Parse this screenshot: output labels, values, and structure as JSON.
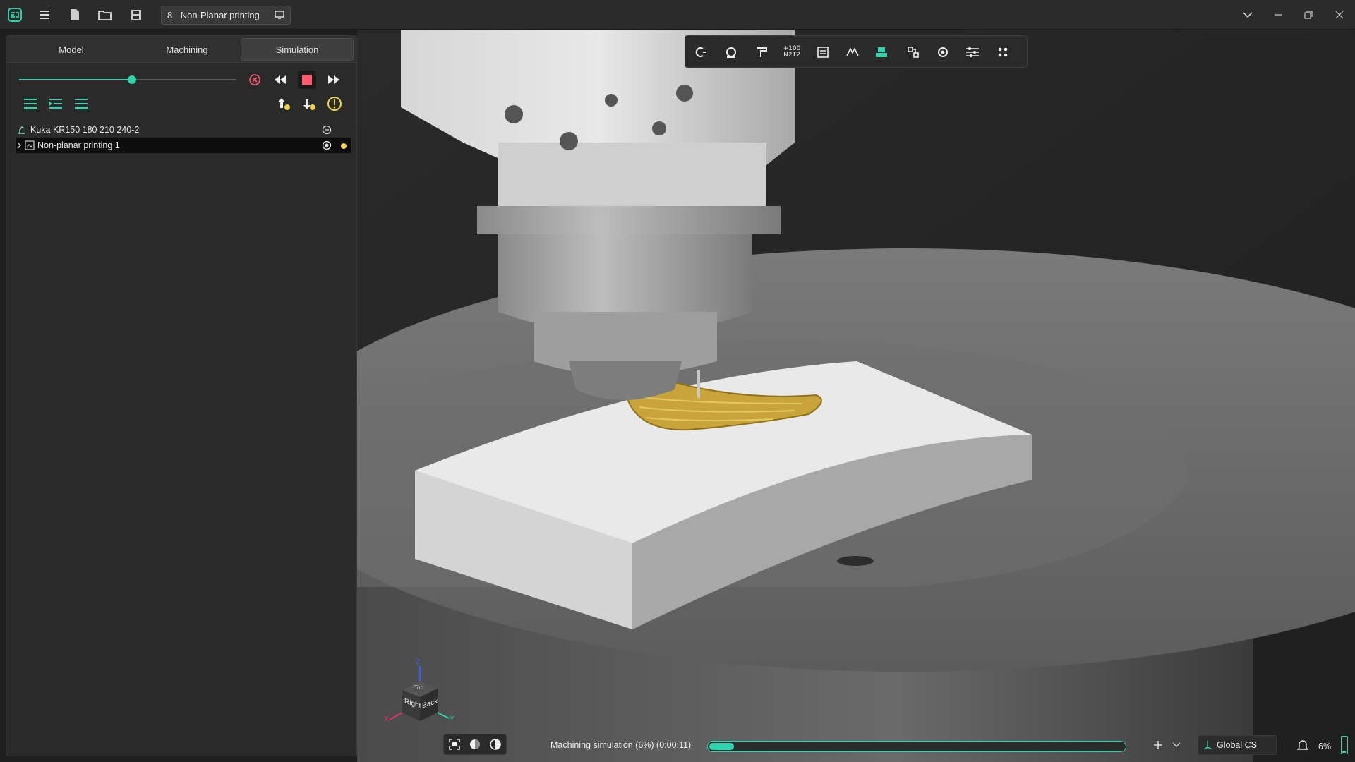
{
  "titlebar": {
    "document_tab": "8 - Non-Planar printing"
  },
  "panel": {
    "tabs": [
      {
        "label": "Model"
      },
      {
        "label": "Machining"
      },
      {
        "label": "Simulation"
      }
    ],
    "active_tab": "Simulation",
    "slider_position": 0.52,
    "tree": [
      {
        "label": "Kuka KR150 180 210 240-2"
      },
      {
        "label": "Non-planar printing 1"
      }
    ]
  },
  "view_toolbar": {
    "ncode_label_top": "+100",
    "ncode_label_bottom": "N2T2"
  },
  "view_cube": {
    "faces": [
      "Right",
      "Back",
      "Top"
    ],
    "axes": [
      "Z",
      "X",
      "Y"
    ]
  },
  "status": {
    "simulation_text": "Machining simulation (6%) (0:00:11)",
    "progress": 0.06,
    "coordinate_system": "Global CS",
    "zoom": "6%"
  },
  "colors": {
    "accent": "#2fd3ad",
    "panel_bg": "#2a2a2a",
    "stop_red": "#ff5a6e",
    "warning_yellow": "#f0d34a",
    "printed_part": "#c9a43a"
  }
}
